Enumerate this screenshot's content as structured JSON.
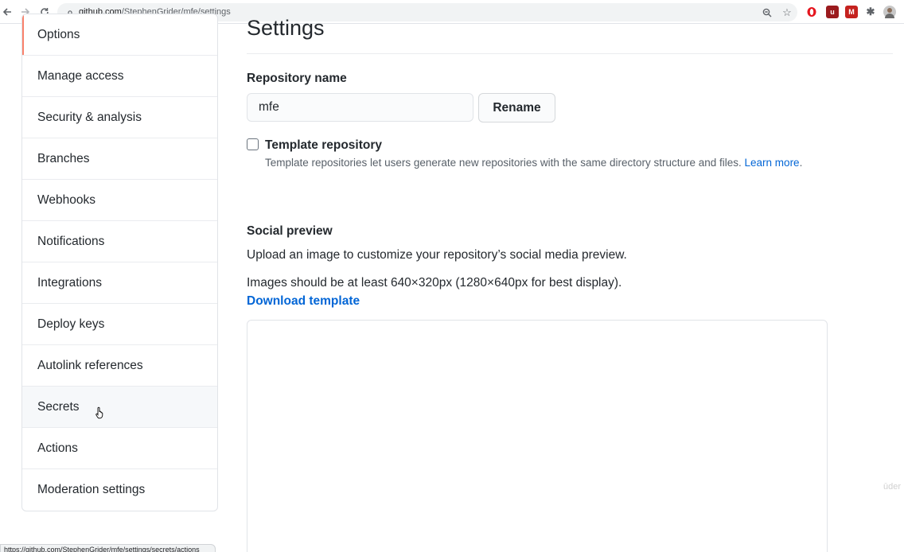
{
  "browser": {
    "url_host": "github.com",
    "url_path": "/StephenGrider/mfe/settings",
    "status_url": "https://github.com/StephenGrider/mfe/settings/secrets/actions"
  },
  "sidebar": {
    "items": [
      {
        "label": "Options",
        "selected": true
      },
      {
        "label": "Manage access"
      },
      {
        "label": "Security & analysis"
      },
      {
        "label": "Branches"
      },
      {
        "label": "Webhooks"
      },
      {
        "label": "Notifications"
      },
      {
        "label": "Integrations"
      },
      {
        "label": "Deploy keys"
      },
      {
        "label": "Autolink references"
      },
      {
        "label": "Secrets",
        "hovered": true
      },
      {
        "label": "Actions"
      },
      {
        "label": "Moderation settings"
      }
    ]
  },
  "main": {
    "title": "Settings",
    "repo_name_label": "Repository name",
    "repo_name_value": "mfe",
    "rename_label": "Rename",
    "template_label": "Template repository",
    "template_note": "Template repositories let users generate new repositories with the same directory structure and files. ",
    "learn_more": "Learn more",
    "period": ".",
    "social_title": "Social preview",
    "social_desc": "Upload an image to customize your repository’s social media preview.",
    "social_size": "Images should be at least 640×320px (1280×640px for best display).",
    "download_template": "Download template"
  },
  "watermark": "ūder",
  "colors": {
    "accent": "#f9826c",
    "link": "#0366d6"
  }
}
